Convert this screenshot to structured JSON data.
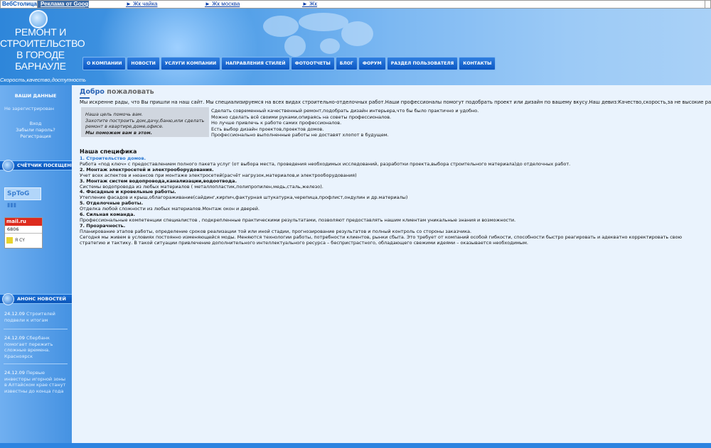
{
  "adbar": {
    "brand": "ВебСтолица.РУ",
    "google": "Реклама от Google",
    "links": [
      "► Жк чайка",
      "► Жк москва",
      "► Жк"
    ]
  },
  "logo": {
    "title_lines": [
      "РЕМОНТ И",
      "СТРОИТЕЛЬСТВО",
      "В ГОРОДЕ",
      "БАРНАУЛЕ"
    ],
    "slogan": "Скорость,качество,доступность"
  },
  "nav": [
    "О КОМПАНИИ",
    "НОВОСТИ",
    "УСЛУГИ КОМПАНИИ",
    "НАПРАВЛЕНИЯ СТИЛЕЙ",
    "ФОТООТЧЕТЫ",
    "БЛОГ",
    "ФОРУМ",
    "РАЗДЕЛ ПОЛЬЗОВАТЕЛЯ",
    "КОНТАКТЫ"
  ],
  "sidebar": {
    "user_title": "ВАШИ ДАННЫЕ",
    "not_registered": "Не зарегистрирован",
    "login": "Вход",
    "forgot": "Забыли пароль?",
    "register": "Регистрация",
    "counter_title": "СЧЁТЧИК ПОСЕЩЕНИЙ",
    "counter1_text": "SpToG",
    "counter2": {
      "top": "mail.ru",
      "num": "6806",
      "bottom": "Я СY"
    },
    "news_title": "АНОНС НОВОСТЕЙ",
    "news": [
      {
        "date": "24.12.09",
        "text": "Строителей подвели к итогам"
      },
      {
        "date": "24.12.09",
        "text": "Сбербанк помогает пережить сложные времена. Красноярск"
      },
      {
        "date": "24.12.09",
        "text": "Первые инвесторы игорной зоны в Алтайском крае станут известны до конца года"
      }
    ]
  },
  "main": {
    "welcome1": "Добро",
    "welcome2": "пожаловать",
    "intro": "Мы искренне рады, что Вы пришли на наш сайт. Мы специализируемся на всех видах строительно-отделочных работ.Наши профессионалы помогут подобрать проект или дизайн по вашему вкусу.Наш девиз:Качество,скорость,за не высокие расценки.",
    "quote_lines": [
      "Наша цель помочь вам.",
      "Захотите построить дом,дачу,баню,или сделать",
      "ремонт в квартире,доме,офисе."
    ],
    "quote_bold": "Мы поможем вам в этом.",
    "right_lines": [
      "Сделать современный качественный ремонт,подобрать дизайн интерьера,что бы было практично и удобно.",
      "Можно сделать всё своими руками,опираясь на советы профессионалов.",
      "Но лучше привлечь к работе самих профессионалов.",
      "Есть выбор дизайн проектов,проектов домов.",
      "Профессионально выполненные работы не доставят хлопот в будущем."
    ],
    "spec_title": "Наша специфика",
    "spec": [
      {
        "h": "1. Строительство домов.",
        "blue": true,
        "p": "Работа «под ключ» с предоставлением полного пакета услуг (от выбора места, проведения необходимых исследований, разработки проекта,выбора строительного материала)до отделочных работ."
      },
      {
        "h": "2. Монтаж электросетей и электрооборудования.",
        "blue": false,
        "p": "Учет всех аспектов и нюансов при монтаже электросетей(расчёт нагрузок,материалов,и электрооборудования)"
      },
      {
        "h": "3. Монтаж систем водопровода,канализации,водоотвода.",
        "blue": false,
        "p": "Системы водопровода из любых материалов ( металлопластик,полипропилен,медь,сталь,железо)."
      },
      {
        "h": "4. Фасадные и кровельные работы.",
        "blue": false,
        "p": "Утепление фасадов и крыш,облагораживание(сайдинг,кирпич,фактурная штукатурка,черепица,профлист,ондулин и др.материалы)"
      },
      {
        "h": "5. Отделочные работы.",
        "blue": false,
        "p": "Отделка любой сложности из любых материалов.Монтаж окон и дверей."
      },
      {
        "h": "6. Сильная команда.",
        "blue": false,
        "p": "Профессиональные компетенции специалистов , подкрепленные практическими результатами, позволяют предоставлять нашим клиентам уникальные знания и возможности."
      },
      {
        "h": "7. Прозрачность.",
        "blue": false,
        "p": "Планирование этапов работы, определение сроков реализации той или иной стадии, прогнозирование результатов и полный контроль со стороны заказчика."
      }
    ],
    "final_text": "Сегодня мы живем в условиях постоянно изменяющейся моды. Меняются технологии работы, потребности клиентов, рынки сбыта. Это требует от компаний особой гибкости, способности быстро реагировать и адекватно корректировать свою стратегию и тактику. В такой ситуации привлечение дополнительного интеллектуального ресурса – беспристрастного, обладающего свежими идеями – оказывается необходимым."
  }
}
